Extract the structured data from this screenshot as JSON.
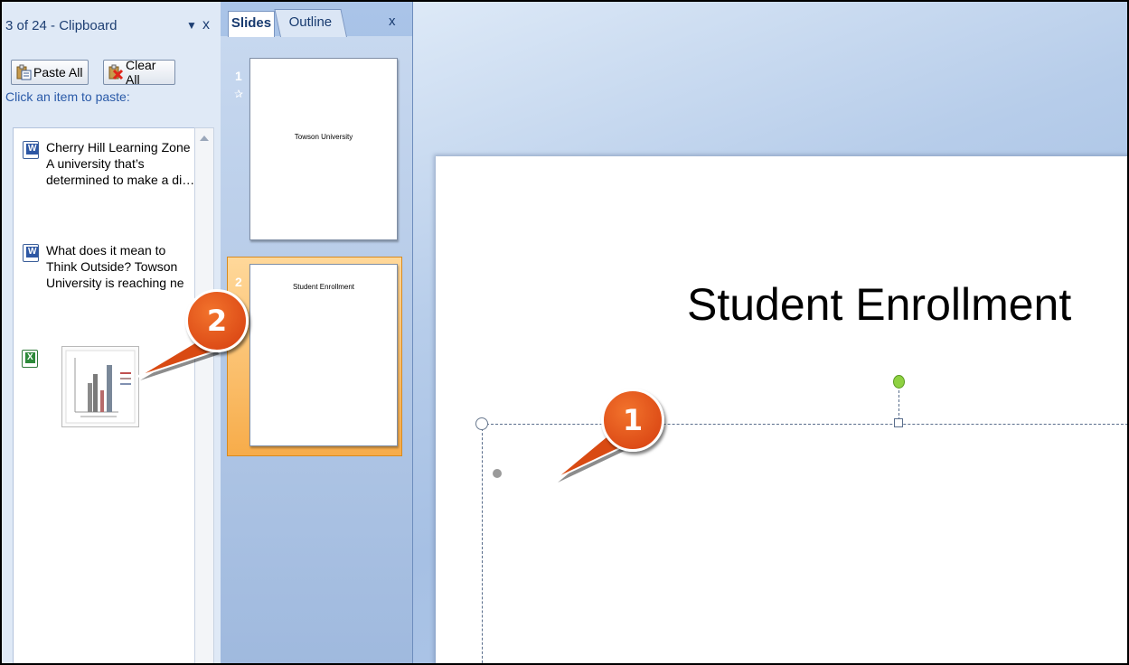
{
  "clipboard": {
    "title": "3 of 24 - Clipboard",
    "dropdown_glyph": "▼",
    "close_glyph": "x",
    "paste_all_label": "Paste All",
    "clear_all_label": "Clear All",
    "hint": "Click an item to paste:",
    "items": [
      {
        "type": "word",
        "text": "Cherry Hill Learning Zone A university that’s determined to make a di…"
      },
      {
        "type": "word",
        "text": "What does it mean to Think Outside? Towson University is reaching ne"
      },
      {
        "type": "excel-chart",
        "text": ""
      }
    ]
  },
  "slides_pane": {
    "tabs": [
      {
        "label": "Slides",
        "active": true
      },
      {
        "label": "Outline",
        "active": false
      }
    ],
    "close_glyph": "x",
    "slides": [
      {
        "number": "1",
        "title": "Towson University",
        "selected": false
      },
      {
        "number": "2",
        "title": "Student Enrollment",
        "selected": true
      }
    ]
  },
  "slide": {
    "title": "Student Enrollment"
  },
  "callouts": [
    {
      "label": "1"
    },
    {
      "label": "2"
    }
  ],
  "colors": {
    "callout": "#d94a12",
    "selection": "#f7ac4a",
    "pane_bg": "#dfe9f6"
  }
}
